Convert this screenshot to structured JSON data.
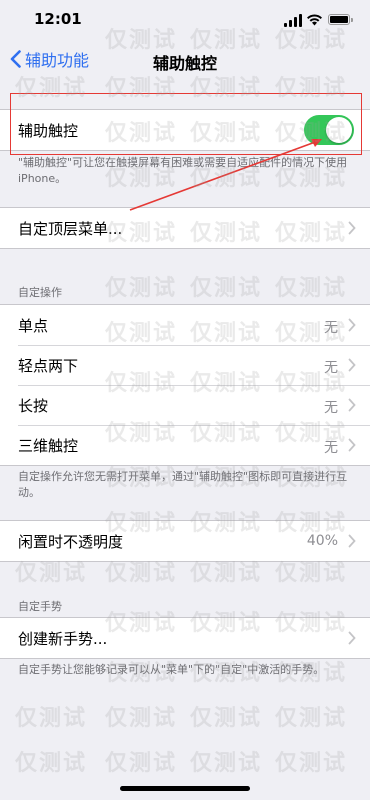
{
  "status_bar": {
    "time": "12:01"
  },
  "nav": {
    "back_label": "辅助功能",
    "title": "辅助触控"
  },
  "toggle_row": {
    "label": "辅助触控",
    "on": true
  },
  "toggle_footnote": "\"辅助触控\"可让您在触摸屏幕有困难或需要自适应配件的情况下使用 iPhone。",
  "custom_menu_row": {
    "label": "自定顶层菜单..."
  },
  "actions_section": {
    "header": "自定操作",
    "rows": [
      {
        "label": "单点",
        "value": "无"
      },
      {
        "label": "轻点两下",
        "value": "无"
      },
      {
        "label": "长按",
        "value": "无"
      },
      {
        "label": "三维触控",
        "value": "无"
      }
    ],
    "footnote": "自定操作允许您无需打开菜单，通过\"辅助触控\"图标即可直接进行互动。"
  },
  "opacity_row": {
    "label": "闲置时不透明度",
    "value": "40%"
  },
  "gestures_section": {
    "header": "自定手势",
    "row_label": "创建新手势...",
    "footnote": "自定手势让您能够记录可以从\"菜单\"下的\"自定\"中激活的手势。"
  },
  "watermark": {
    "text": "仅测试"
  },
  "colors": {
    "accent": "#2f6ff0",
    "toggle_on": "#34c759",
    "annotation": "#e53935"
  }
}
